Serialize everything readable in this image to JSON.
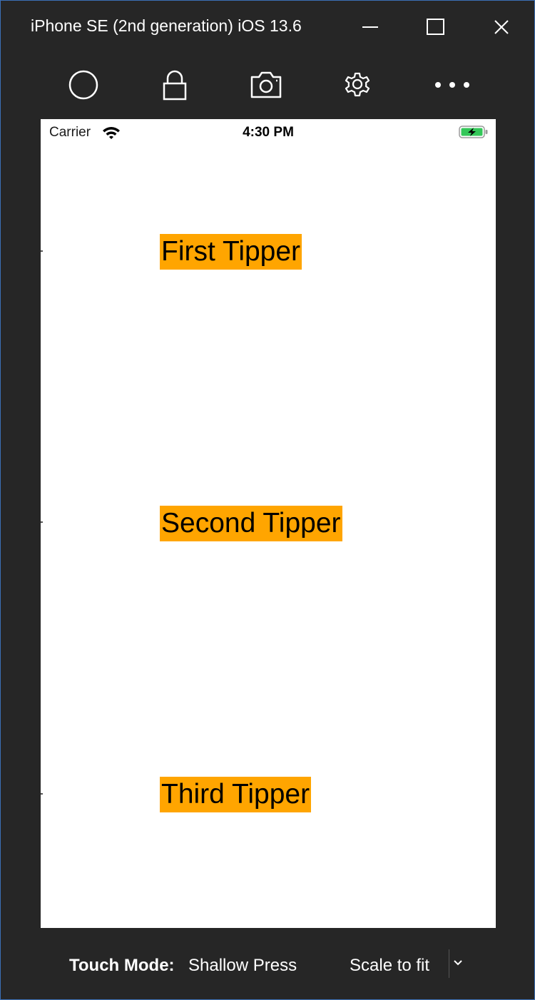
{
  "window": {
    "title": "iPhone SE (2nd generation) iOS 13.6",
    "accent_color": "#3b6fb6",
    "background_color": "#262626",
    "controls": [
      "minimize-icon",
      "maximize-icon",
      "close-icon"
    ]
  },
  "toolbar": {
    "items": [
      {
        "icon": "home-circle-icon"
      },
      {
        "icon": "lock-icon"
      },
      {
        "icon": "camera-icon"
      },
      {
        "icon": "gear-icon"
      },
      {
        "icon": "more-icon"
      }
    ]
  },
  "status_bar": {
    "carrier": "Carrier",
    "time": "4:30 PM",
    "battery_color": "#34c759"
  },
  "content": {
    "tipper_color": "#ffa500",
    "tippers": [
      {
        "label": "First Tipper"
      },
      {
        "label": "Second Tipper"
      },
      {
        "label": "Third Tipper"
      }
    ]
  },
  "bottom_bar": {
    "touch_mode_label": "Touch Mode:",
    "touch_mode_value": "Shallow Press",
    "scale_option": "Scale to fit"
  }
}
